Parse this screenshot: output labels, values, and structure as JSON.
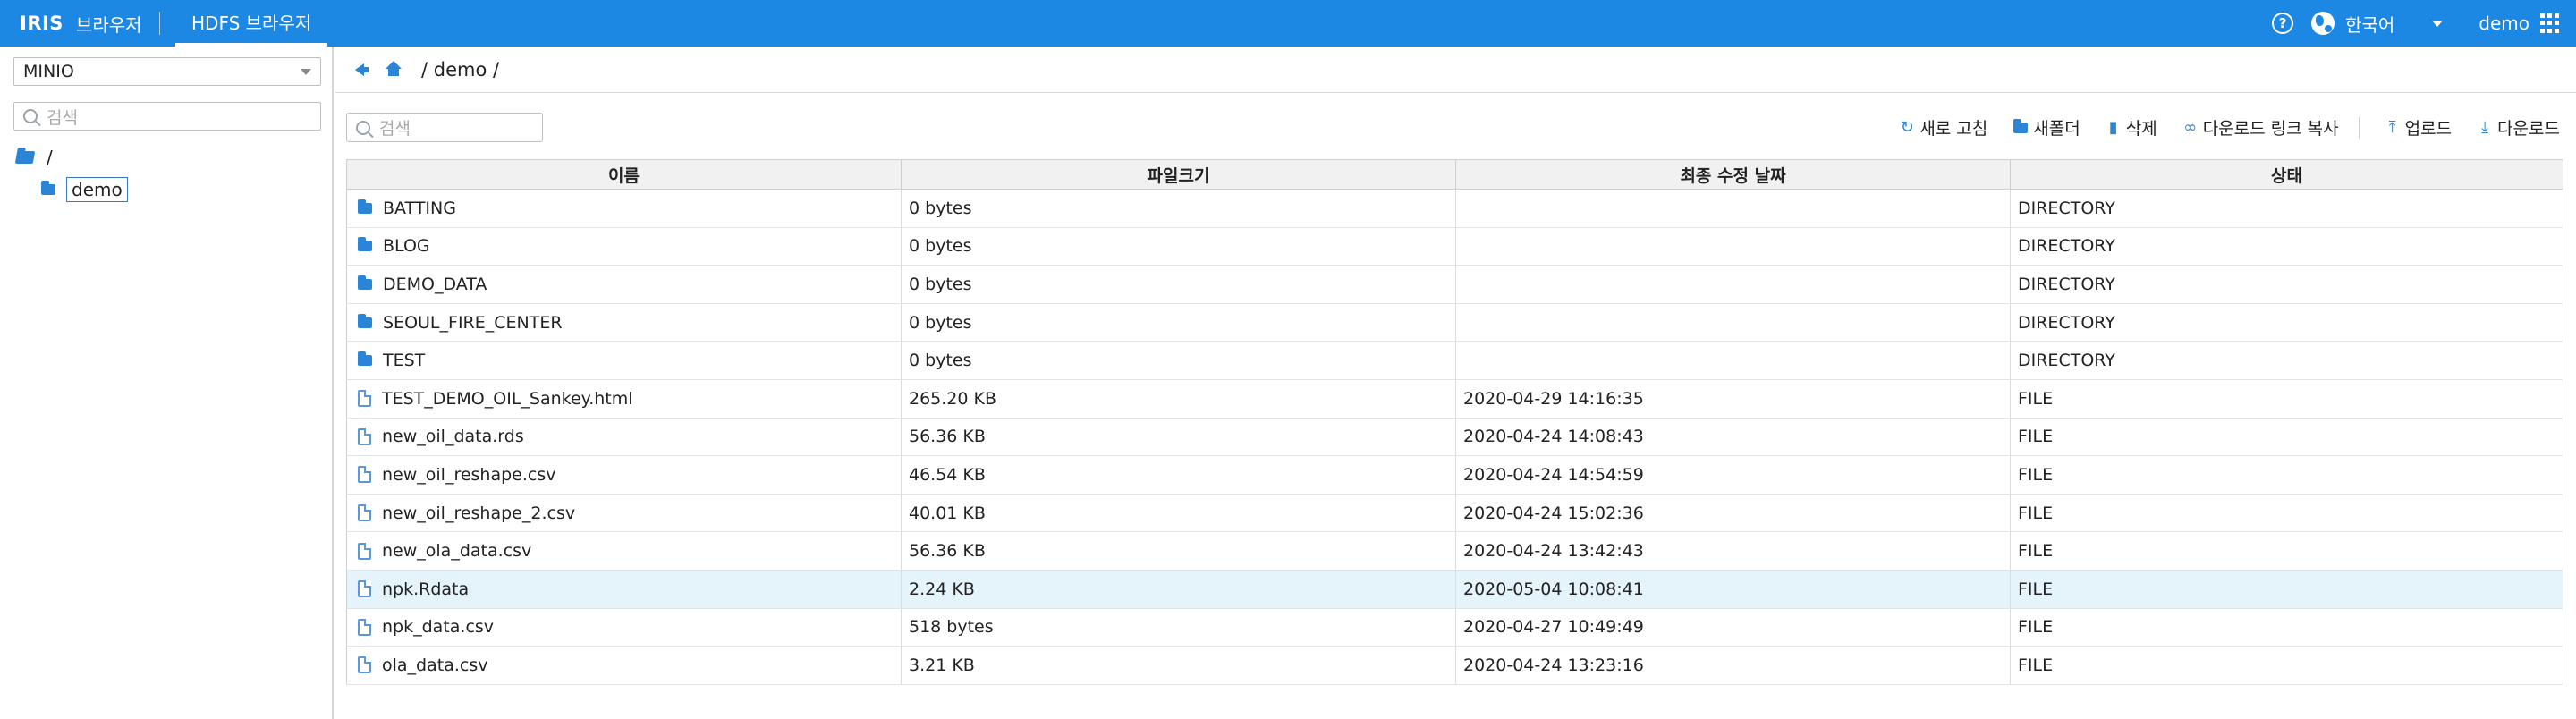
{
  "header": {
    "logo": "IRIS",
    "app_label": "브라우저",
    "active_tab": "HDFS 브라우저",
    "language": "한국어",
    "user": "demo"
  },
  "sidebar": {
    "source_select": "MINIO",
    "search_placeholder": "검색",
    "tree": {
      "root": "/",
      "child": "demo"
    }
  },
  "main": {
    "path": "/ demo /",
    "search_placeholder": "검색",
    "toolbar": {
      "refresh": "새로 고침",
      "new_folder": "새폴더",
      "delete": "삭제",
      "copy_link": "다운로드 링크 복사",
      "upload": "업로드",
      "download": "다운로드"
    },
    "table": {
      "columns": [
        "이름",
        "파일크기",
        "최종 수정 날짜",
        "상태"
      ],
      "rows": [
        {
          "name": "BATTING",
          "size": "0 bytes",
          "modified": "",
          "status": "DIRECTORY",
          "kind": "folder"
        },
        {
          "name": "BLOG",
          "size": "0 bytes",
          "modified": "",
          "status": "DIRECTORY",
          "kind": "folder"
        },
        {
          "name": "DEMO_DATA",
          "size": "0 bytes",
          "modified": "",
          "status": "DIRECTORY",
          "kind": "folder"
        },
        {
          "name": "SEOUL_FIRE_CENTER",
          "size": "0 bytes",
          "modified": "",
          "status": "DIRECTORY",
          "kind": "folder"
        },
        {
          "name": "TEST",
          "size": "0 bytes",
          "modified": "",
          "status": "DIRECTORY",
          "kind": "folder"
        },
        {
          "name": "TEST_DEMO_OIL_Sankey.html",
          "size": "265.20 KB",
          "modified": "2020-04-29 14:16:35",
          "status": "FILE",
          "kind": "file"
        },
        {
          "name": "new_oil_data.rds",
          "size": "56.36 KB",
          "modified": "2020-04-24 14:08:43",
          "status": "FILE",
          "kind": "file"
        },
        {
          "name": "new_oil_reshape.csv",
          "size": "46.54 KB",
          "modified": "2020-04-24 14:54:59",
          "status": "FILE",
          "kind": "file"
        },
        {
          "name": "new_oil_reshape_2.csv",
          "size": "40.01 KB",
          "modified": "2020-04-24 15:02:36",
          "status": "FILE",
          "kind": "file"
        },
        {
          "name": "new_ola_data.csv",
          "size": "56.36 KB",
          "modified": "2020-04-24 13:42:43",
          "status": "FILE",
          "kind": "file"
        },
        {
          "name": "npk.Rdata",
          "size": "2.24 KB",
          "modified": "2020-05-04 10:08:41",
          "status": "FILE",
          "kind": "file",
          "highlighted": true
        },
        {
          "name": "npk_data.csv",
          "size": "518 bytes",
          "modified": "2020-04-27 10:49:49",
          "status": "FILE",
          "kind": "file"
        },
        {
          "name": "ola_data.csv",
          "size": "3.21 KB",
          "modified": "2020-04-24 13:23:16",
          "status": "FILE",
          "kind": "file"
        }
      ]
    }
  },
  "colors": {
    "header_bg": "#1d87e4",
    "icon_blue": "#2b85d6",
    "row_highlight": "#e5f3fb"
  }
}
